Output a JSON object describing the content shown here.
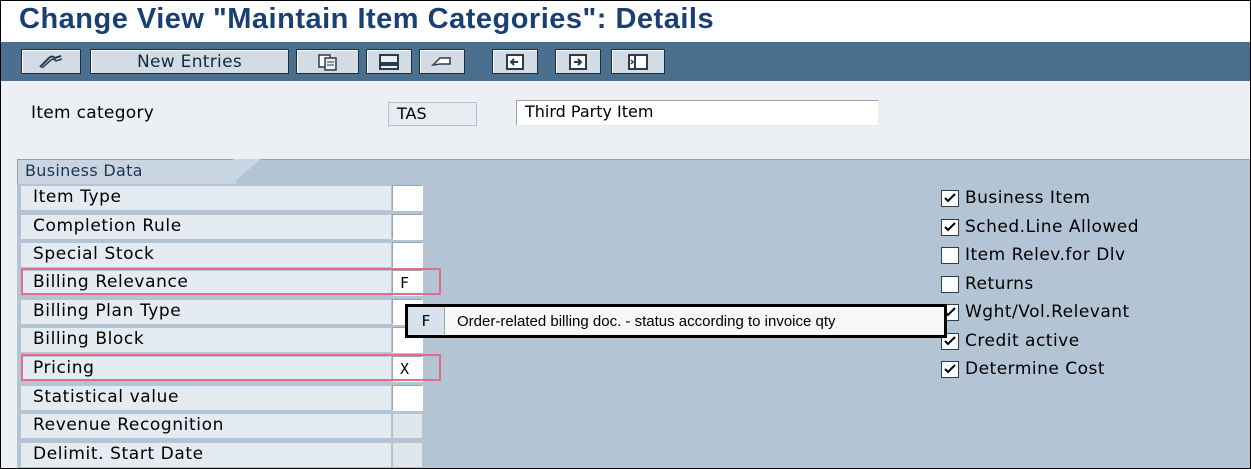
{
  "title": "Change View \"Maintain Item Categories\": Details",
  "toolbar": {
    "new_entries_label": "New Entries",
    "icons": [
      "change-display-icon",
      "copy-icon",
      "save-icon",
      "undo-icon",
      "previous-entry-icon",
      "next-entry-icon",
      "other-entry-icon"
    ]
  },
  "header": {
    "item_category_label": "Item category",
    "item_category_code": "TAS",
    "item_category_desc": "Third Party Item"
  },
  "business_data": {
    "group_title": "Business Data",
    "fields": [
      {
        "label": "Item Type",
        "value": ""
      },
      {
        "label": "Completion Rule",
        "value": ""
      },
      {
        "label": "Special Stock",
        "value": ""
      },
      {
        "label": "Billing Relevance",
        "value": "F"
      },
      {
        "label": "Billing Plan Type",
        "value": ""
      },
      {
        "label": "Billing Block",
        "value": ""
      },
      {
        "label": "Pricing",
        "value": "X"
      },
      {
        "label": "Statistical value",
        "value": ""
      },
      {
        "label": "Revenue Recognition",
        "value": ""
      },
      {
        "label": "Delimit. Start Date",
        "value": ""
      }
    ],
    "checkboxes": [
      {
        "label": "Business Item",
        "checked": true
      },
      {
        "label": "Sched.Line Allowed",
        "checked": true
      },
      {
        "label": "Item Relev.for Dlv",
        "checked": false
      },
      {
        "label": "Returns",
        "checked": false
      },
      {
        "label": "Wght/Vol.Relevant",
        "checked": true
      },
      {
        "label": "Credit active",
        "checked": true
      },
      {
        "label": "Determine Cost",
        "checked": true
      }
    ]
  },
  "tooltip": {
    "key": "F",
    "text": "Order-related billing doc. - status according to invoice qty"
  },
  "colors": {
    "title": "#1a3f73",
    "toolbar": "#4b6f8e",
    "group_background": "#b3c4d4",
    "highlight": "#e66a8a"
  }
}
